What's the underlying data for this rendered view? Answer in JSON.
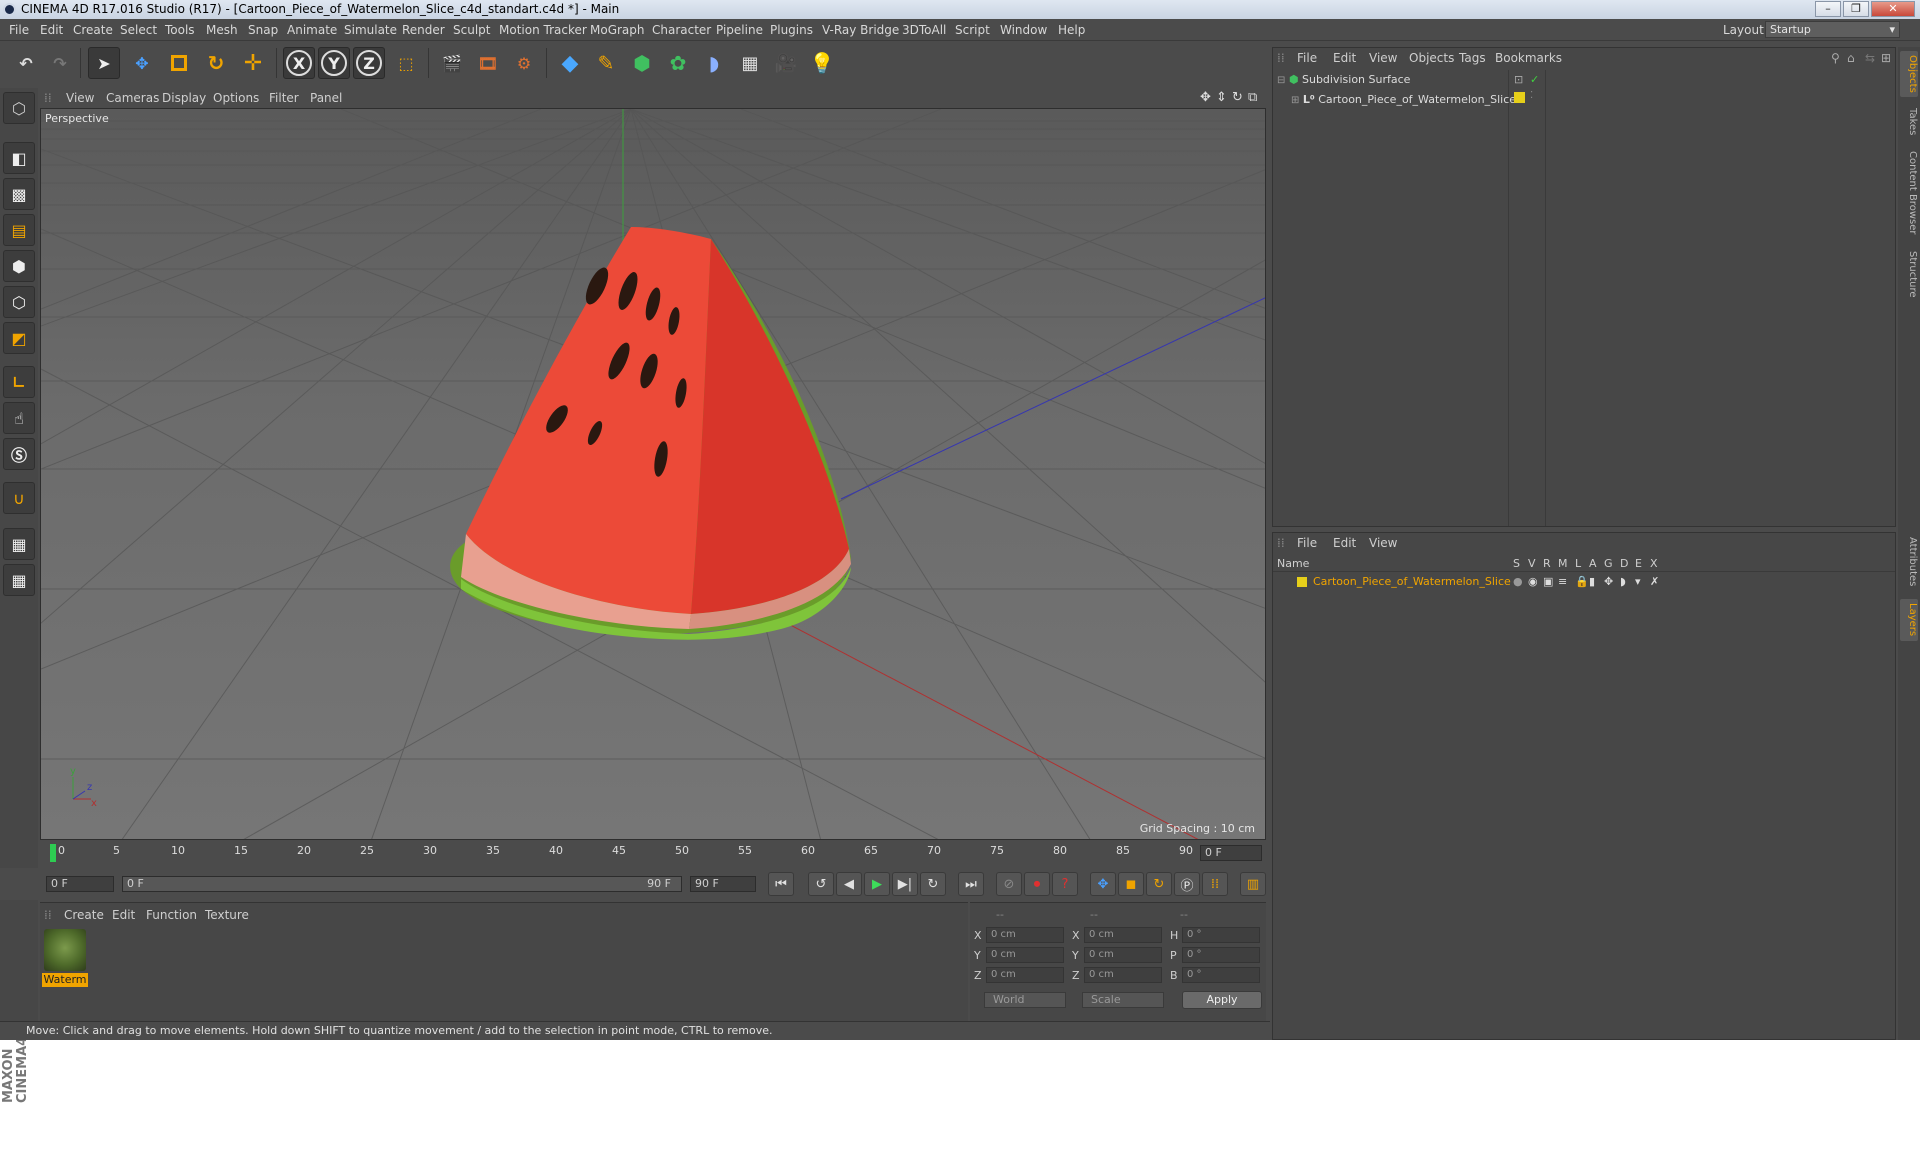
{
  "window": {
    "title": "CINEMA 4D R17.016 Studio (R17) - [Cartoon_Piece_of_Watermelon_Slice_c4d_standart.c4d *] - Main",
    "controls": [
      "–",
      "❐",
      "✕"
    ]
  },
  "menubar": {
    "items": [
      "File",
      "Edit",
      "Create",
      "Select",
      "Tools",
      "Mesh",
      "Snap",
      "Animate",
      "Simulate",
      "Render",
      "Sculpt",
      "Motion Tracker",
      "MoGraph",
      "Character",
      "Pipeline",
      "Plugins",
      "V-Ray Bridge",
      "3DToAll",
      "Script",
      "Window",
      "Help"
    ],
    "layout_label": "Layout:",
    "layout_value": "Startup"
  },
  "toolbar": {
    "tools": [
      "undo-icon",
      "redo-icon",
      "select-arrow-icon",
      "move-icon",
      "scale-icon",
      "rotate-icon",
      "move-plus-icon",
      "x-axis-icon",
      "y-axis-icon",
      "z-axis-icon",
      "coordinate-system-icon",
      "render-view-icon",
      "render-picture-icon",
      "render-settings-icon",
      "cube-icon",
      "pen-spline-icon",
      "subdivision-icon",
      "cloner-icon",
      "deformer-icon",
      "floor-icon",
      "camera-icon",
      "light-icon"
    ],
    "axis_labels": [
      "X",
      "Y",
      "Z"
    ]
  },
  "viewport": {
    "menu": [
      "View",
      "Cameras",
      "Display",
      "Options",
      "Filter",
      "Panel"
    ],
    "label": "Perspective",
    "grid_spacing": "Grid Spacing : 10 cm"
  },
  "timeline": {
    "ticks": [
      "0",
      "5",
      "10",
      "15",
      "20",
      "25",
      "30",
      "35",
      "40",
      "45",
      "50",
      "55",
      "60",
      "65",
      "70",
      "75",
      "80",
      "85",
      "90"
    ],
    "current_frame": "0 F",
    "start_frame": "0 F",
    "range_start": "0 F",
    "range_end": "90 F",
    "end_frame": "90 F"
  },
  "material_manager": {
    "menu": [
      "Create",
      "Edit",
      "Function",
      "Texture"
    ],
    "material_name": "Waterm"
  },
  "coordinates": {
    "headers": [
      "--",
      "--",
      "--"
    ],
    "rows": [
      {
        "axis": "X",
        "pos": "0 cm",
        "axis2": "X",
        "size": "0 cm",
        "rot_axis": "H",
        "rot": "0 °"
      },
      {
        "axis": "Y",
        "pos": "0 cm",
        "axis2": "Y",
        "size": "0 cm",
        "rot_axis": "P",
        "rot": "0 °"
      },
      {
        "axis": "Z",
        "pos": "0 cm",
        "axis2": "Z",
        "size": "0 cm",
        "rot_axis": "B",
        "rot": "0 °"
      }
    ],
    "mode1": "World",
    "mode2": "Scale",
    "apply_label": "Apply"
  },
  "status_bar": "Move: Click and drag to move elements. Hold down SHIFT to quantize movement / add to the selection in point mode, CTRL to remove.",
  "object_manager": {
    "menu": [
      "File",
      "Edit",
      "View",
      "Objects",
      "Tags",
      "Bookmarks"
    ],
    "objects": [
      "Subdivision Surface",
      "Cartoon_Piece_of_Watermelon_Slice"
    ]
  },
  "layer_manager": {
    "menu": [
      "File",
      "Edit",
      "View"
    ],
    "columns": [
      "Name",
      "S",
      "V",
      "R",
      "M",
      "L",
      "A",
      "G",
      "D",
      "E",
      "X"
    ],
    "layer_name": "Cartoon_Piece_of_Watermelon_Slice",
    "layer_color": "#e6cf1a"
  },
  "side_tabs": [
    "Objects",
    "Takes",
    "Content Browser",
    "Structure",
    "Attributes",
    "Layers"
  ],
  "colors": {
    "accent_orange": "#f0a400",
    "x_axis": "#c03030",
    "y_axis": "#30a030",
    "z_axis": "#3030c0"
  }
}
